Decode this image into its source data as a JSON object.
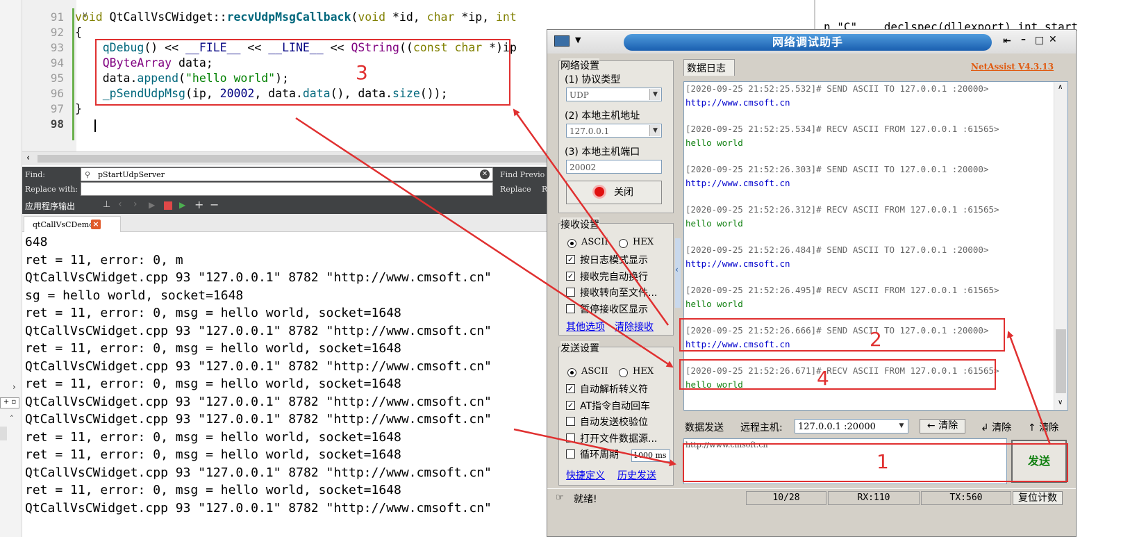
{
  "editor": {
    "lines": [
      {
        "num": "91",
        "parts": [
          [
            "kw",
            "void "
          ],
          [
            "plain",
            "QtCallVsCWidget::"
          ],
          [
            "fnb",
            "recvUdpMsgCallback"
          ],
          [
            "plain",
            "("
          ],
          [
            "kw",
            "void "
          ],
          [
            "plain",
            "*id, "
          ],
          [
            "kw",
            "char "
          ],
          [
            "plain",
            "*ip, "
          ],
          [
            "kw",
            "int"
          ]
        ]
      },
      {
        "num": "92",
        "parts": [
          [
            "plain",
            "{"
          ]
        ]
      },
      {
        "num": "93",
        "parts": [
          [
            "plain",
            "    "
          ],
          [
            "fn",
            "qDebug"
          ],
          [
            "plain",
            "() << "
          ],
          [
            "mac",
            "__FILE__"
          ],
          [
            "plain",
            " << "
          ],
          [
            "mac",
            "__LINE__"
          ],
          [
            "plain",
            " << "
          ],
          [
            "typ",
            "QString"
          ],
          [
            "plain",
            "(("
          ],
          [
            "kw",
            "const char "
          ],
          [
            "plain",
            "*)ip"
          ]
        ]
      },
      {
        "num": "94",
        "parts": [
          [
            "plain",
            "    "
          ],
          [
            "typ",
            "QByteArray "
          ],
          [
            "plain",
            "data;"
          ]
        ]
      },
      {
        "num": "95",
        "parts": [
          [
            "plain",
            "    data."
          ],
          [
            "fn",
            "append"
          ],
          [
            "plain",
            "("
          ],
          [
            "str",
            "\"hello world\""
          ],
          [
            "plain",
            ");"
          ]
        ]
      },
      {
        "num": "96",
        "parts": [
          [
            "plain",
            "    "
          ],
          [
            "fn",
            "_pSendUdpMsg"
          ],
          [
            "plain",
            "(ip, "
          ],
          [
            "num",
            "20002"
          ],
          [
            "plain",
            ", data."
          ],
          [
            "fn",
            "data"
          ],
          [
            "plain",
            "(), data."
          ],
          [
            "fn",
            "size"
          ],
          [
            "plain",
            "());"
          ]
        ]
      },
      {
        "num": "97",
        "parts": [
          [
            "plain",
            "}"
          ]
        ]
      },
      {
        "num": "98",
        "parts": []
      }
    ],
    "top_right_code": "n \"C\"  __declspec(dllexport) int start"
  },
  "find_bar": {
    "find_label": "Find:",
    "find_value": "pStartUdpServer",
    "replace_label": "Replace with:",
    "find_previous": "Find Previo",
    "replace": "Replace"
  },
  "output_panel": {
    "title": "应用程序输出",
    "tab_name": "qtCallVsCDemo",
    "lines": [
      "648",
      "ret = 11, error: 0, m",
      "QtCallVsCWidget.cpp 93 \"127.0.0.1\" 8782 \"http://www.cmsoft.cn\"",
      "sg = hello world, socket=1648",
      "ret = 11, error: 0, msg = hello world, socket=1648",
      "QtCallVsCWidget.cpp 93 \"127.0.0.1\" 8782 \"http://www.cmsoft.cn\"",
      "ret = 11, error: 0, msg = hello world, socket=1648",
      "QtCallVsCWidget.cpp 93 \"127.0.0.1\" 8782 \"http://www.cmsoft.cn\"",
      "ret = 11, error: 0, msg = hello world, socket=1648",
      "QtCallVsCWidget.cpp 93 \"127.0.0.1\" 8782 \"http://www.cmsoft.cn\"",
      "QtCallVsCWidget.cpp 93 \"127.0.0.1\" 8782 \"http://www.cmsoft.cn\"",
      "ret = 11, error: 0, msg = hello world, socket=1648",
      "ret = 11, error: 0, msg = hello world, socket=1648",
      "QtCallVsCWidget.cpp 93 \"127.0.0.1\" 8782 \"http://www.cmsoft.cn\"",
      "ret = 11, error: 0, msg = hello world, socket=1648",
      "QtCallVsCWidget.cpp 93 \"127.0.0.1\" 8782 \"http://www.cmsoft.cn\""
    ]
  },
  "netassist": {
    "title": "网络调试助手",
    "version": "NetAssist V4.3.13",
    "net_settings": {
      "label": "网络设置",
      "protocol_label": "(1) 协议类型",
      "protocol_value": "UDP",
      "host_label": "(2) 本地主机地址",
      "host_value": "127.0.0.1",
      "port_label": "(3) 本地主机端口",
      "port_value": "20002",
      "close_button": "关闭"
    },
    "recv_settings": {
      "label": "接收设置",
      "ascii": "ASCII",
      "hex": "HEX",
      "options": [
        {
          "label": "按日志模式显示",
          "checked": true
        },
        {
          "label": "接收完自动换行",
          "checked": true
        },
        {
          "label": "接收转向至文件...",
          "checked": false
        },
        {
          "label": "暂停接收区显示",
          "checked": false
        }
      ],
      "more_options": "其他选项",
      "clear_recv": "清除接收"
    },
    "send_settings": {
      "label": "发送设置",
      "ascii": "ASCII",
      "hex": "HEX",
      "options": [
        {
          "label": "自动解析转义符",
          "checked": true
        },
        {
          "label": "AT指令自动回车",
          "checked": true
        },
        {
          "label": "自动发送校验位",
          "checked": false
        },
        {
          "label": "打开文件数据源...",
          "checked": false
        },
        {
          "label": "循环周期",
          "checked": false
        }
      ],
      "cycle_value": "1000",
      "cycle_unit": "ms",
      "shortcut": "快捷定义",
      "history": "历史发送"
    },
    "log_tab": "数据日志",
    "log": [
      {
        "header": "[2020-09-25 21:52:25.532]# SEND ASCII TO 127.0.0.1 :20000>",
        "data": "http://www.cmsoft.cn",
        "kind": "send"
      },
      {
        "header": "[2020-09-25 21:52:25.534]# RECV ASCII FROM 127.0.0.1 :61565>",
        "data": "hello world",
        "kind": "recv"
      },
      {
        "header": "[2020-09-25 21:52:26.303]# SEND ASCII TO 127.0.0.1 :20000>",
        "data": "http://www.cmsoft.cn",
        "kind": "send"
      },
      {
        "header": "[2020-09-25 21:52:26.312]# RECV ASCII FROM 127.0.0.1 :61565>",
        "data": "hello world",
        "kind": "recv"
      },
      {
        "header": "[2020-09-25 21:52:26.484]# SEND ASCII TO 127.0.0.1 :20000>",
        "data": "http://www.cmsoft.cn",
        "kind": "send"
      },
      {
        "header": "[2020-09-25 21:52:26.495]# RECV ASCII FROM 127.0.0.1 :61565>",
        "data": "hello world",
        "kind": "recv"
      },
      {
        "header": "[2020-09-25 21:52:26.666]# SEND ASCII TO 127.0.0.1 :20000>",
        "data": "http://www.cmsoft.cn",
        "kind": "send"
      },
      {
        "header": "[2020-09-25 21:52:26.671]# RECV ASCII FROM 127.0.0.1 :61565>",
        "data": "hello world",
        "kind": "recv"
      }
    ],
    "send_bar": {
      "data_send": "数据发送",
      "remote_host_label": "远程主机:",
      "remote_host_value": "127.0.0.1 :20000",
      "clear1": "清除",
      "clear2": "清除",
      "clear3": "清除"
    },
    "send_text": "http://www.cmsoft.cn",
    "send_button": "发送",
    "status": {
      "ready": "就绪!",
      "count": "10/28",
      "rx": "RX:110",
      "tx": "TX:560",
      "reset": "复位计数"
    }
  },
  "annotations": {
    "labels": [
      "3",
      "2",
      "4",
      "1"
    ],
    "color": "#e03030"
  },
  "colors": {
    "send_data": "#0000cc",
    "recv_data": "#118011",
    "title_bar": "#2a75c8"
  }
}
